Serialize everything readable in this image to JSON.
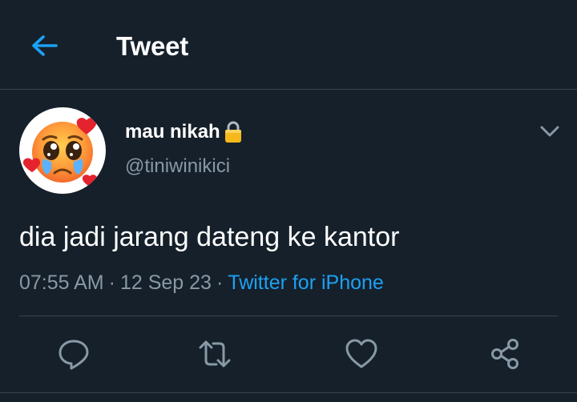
{
  "header": {
    "title": "Tweet",
    "back_icon": "arrow-left-icon"
  },
  "tweet": {
    "author": {
      "display_name": "mau nikah",
      "handle": "@tiniwinikici",
      "lock_icon": "lock-icon",
      "avatar_icon": "pleading-face-with-hearts-icon"
    },
    "text": "dia jadi jarang dateng ke kantor",
    "time": "07:55 AM",
    "separator": "·",
    "date": "12 Sep 23",
    "source": "Twitter for iPhone"
  },
  "actions": [
    "reply-icon",
    "retweet-icon",
    "like-icon",
    "share-icon"
  ],
  "colors": {
    "background": "#15202b",
    "accent": "#1da1f2",
    "secondary_text": "#8899a6",
    "divider": "#38444d"
  }
}
